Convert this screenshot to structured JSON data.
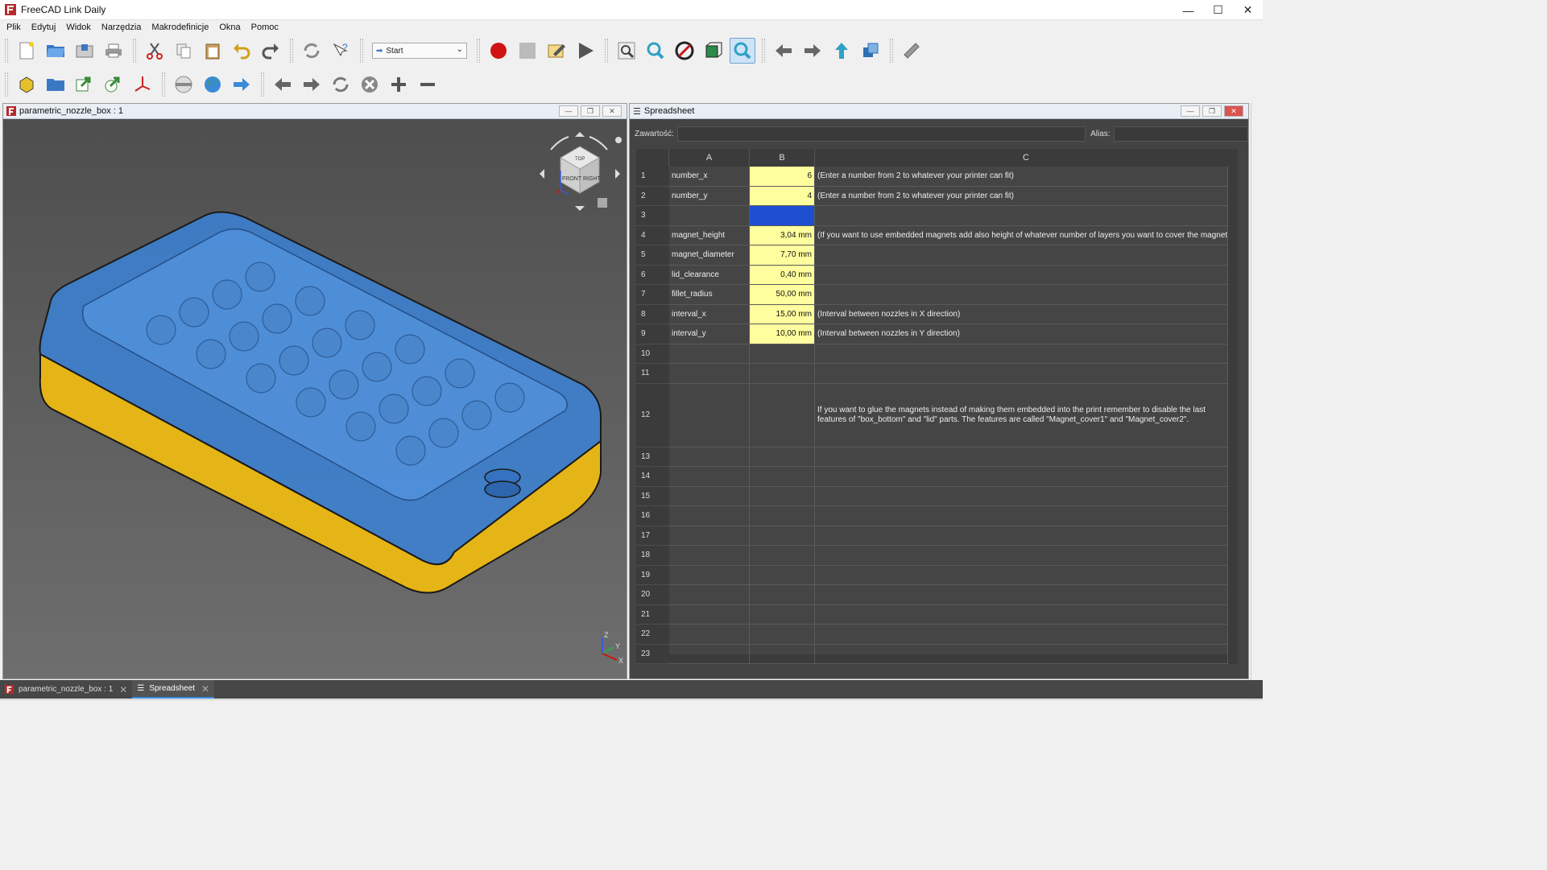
{
  "window": {
    "title": "FreeCAD Link Daily",
    "minimize": "—",
    "maximize": "☐",
    "close": "✕"
  },
  "menu": [
    "Plik",
    "Edytuj",
    "Widok",
    "Narzędzia",
    "Makrodefinicje",
    "Okna",
    "Pomoc"
  ],
  "toolbar": {
    "workbench": "Start"
  },
  "view3d": {
    "title": "parametric_nozzle_box : 1",
    "navcube": {
      "top": "TOP",
      "front": "FRONT",
      "right": "RIGHT"
    },
    "axis": {
      "z": "Z",
      "y": "Y",
      "x": "X"
    }
  },
  "spreadsheet": {
    "title": "Spreadsheet",
    "content_label": "Zawartość:",
    "alias_label": "Alias:",
    "columns": [
      "A",
      "B",
      "C"
    ],
    "rows": [
      {
        "n": "1",
        "a": "number_x",
        "b": "6",
        "c": "(Enter a number from 2 to whatever your printer can fit)"
      },
      {
        "n": "2",
        "a": "number_y",
        "b": "4",
        "c": "(Enter a number from 2 to whatever your printer can fit)"
      },
      {
        "n": "3",
        "a": "",
        "b": "",
        "c": ""
      },
      {
        "n": "4",
        "a": "magnet_height",
        "b": "3,04 mm",
        "c": "(If you want to use embedded magnets add also height of whatever number of layers you want to cover the magnet with)"
      },
      {
        "n": "5",
        "a": "magnet_diameter",
        "b": "7,70 mm",
        "c": ""
      },
      {
        "n": "6",
        "a": "lid_clearance",
        "b": "0,40 mm",
        "c": ""
      },
      {
        "n": "7",
        "a": "fillet_radius",
        "b": "50,00 mm",
        "c": ""
      },
      {
        "n": "8",
        "a": "interval_x",
        "b": "15,00 mm",
        "c": "(Interval between nozzles in X direction)"
      },
      {
        "n": "9",
        "a": "interval_y",
        "b": "10,00 mm",
        "c": "(Interval between nozzles in Y direction)"
      },
      {
        "n": "10",
        "a": "",
        "b": "",
        "c": ""
      },
      {
        "n": "11",
        "a": "",
        "b": "",
        "c": ""
      },
      {
        "n": "12",
        "a": "",
        "b": "",
        "c": "If you want to glue the magnets instead of making them embedded into the print remember to disable the last features of \"box_bottom\" and \"lid\" parts. The features are called \"Magnet_cover1\" and \"Magnet_cover2\"."
      },
      {
        "n": "13",
        "a": "",
        "b": "",
        "c": ""
      },
      {
        "n": "14",
        "a": "",
        "b": "",
        "c": ""
      },
      {
        "n": "15",
        "a": "",
        "b": "",
        "c": ""
      },
      {
        "n": "16",
        "a": "",
        "b": "",
        "c": ""
      },
      {
        "n": "17",
        "a": "",
        "b": "",
        "c": ""
      },
      {
        "n": "18",
        "a": "",
        "b": "",
        "c": ""
      },
      {
        "n": "19",
        "a": "",
        "b": "",
        "c": ""
      },
      {
        "n": "20",
        "a": "",
        "b": "",
        "c": ""
      },
      {
        "n": "21",
        "a": "",
        "b": "",
        "c": ""
      },
      {
        "n": "22",
        "a": "",
        "b": "",
        "c": ""
      },
      {
        "n": "23",
        "a": "",
        "b": "",
        "c": ""
      }
    ]
  },
  "tabs": [
    {
      "label": "parametric_nozzle_box : 1",
      "selected": false
    },
    {
      "label": "Spreadsheet",
      "selected": true
    }
  ],
  "colors": {
    "cell_yellow": "#fffe9e",
    "selected_cell": "#1f4fd1",
    "lid_blue": "#3b82d6",
    "base_yellow": "#e5b416"
  }
}
